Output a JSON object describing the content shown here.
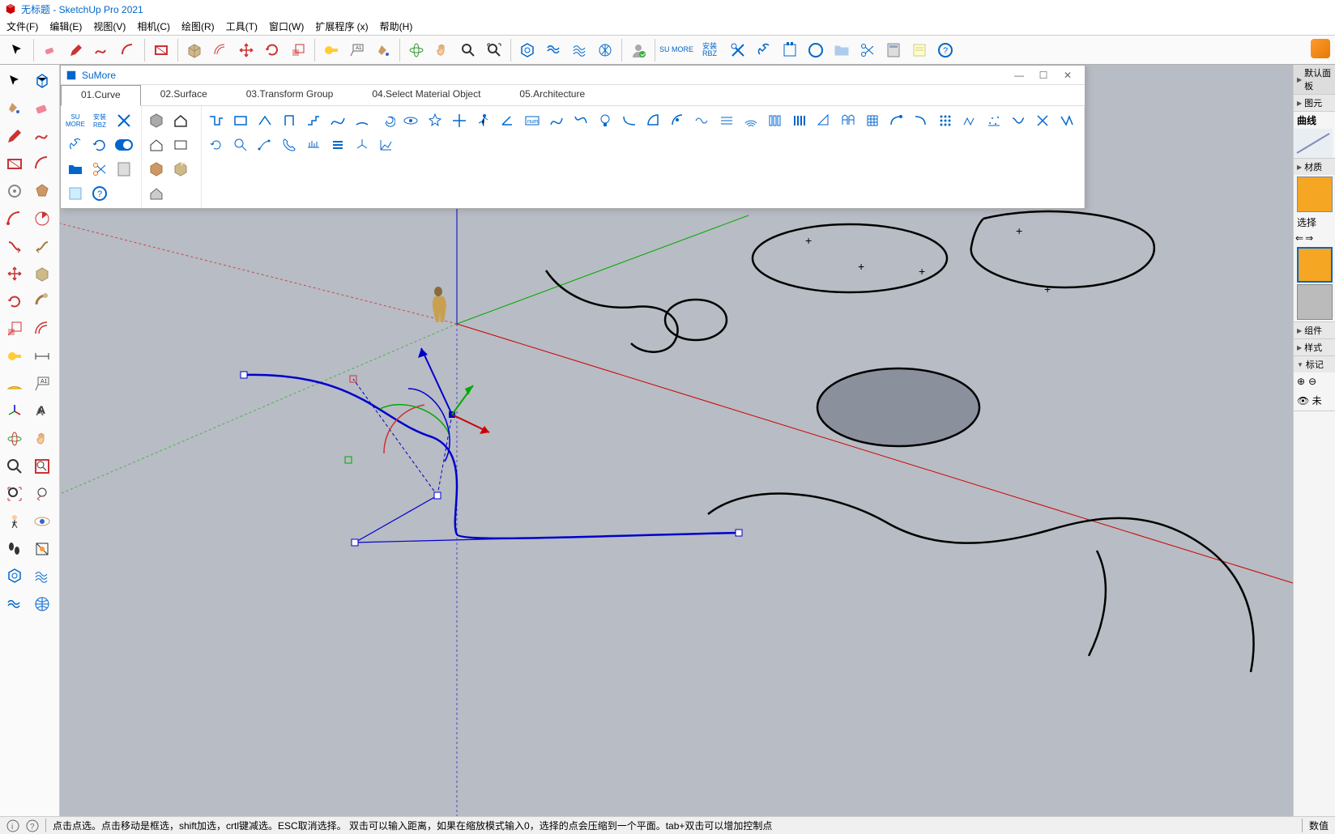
{
  "title": "无标题 - SketchUp Pro 2021",
  "menubar": [
    "文件(F)",
    "编辑(E)",
    "视图(V)",
    "相机(C)",
    "绘图(R)",
    "工具(T)",
    "窗口(W)",
    "扩展程序 (x)",
    "帮助(H)"
  ],
  "sumore": {
    "title": "SuMore",
    "tabs": [
      "01.Curve",
      "02.Surface",
      "03.Transform Group",
      "04.Select Material Object",
      "05.Architecture"
    ],
    "active_tab": 0
  },
  "right_panel": {
    "sections": [
      "默认面板",
      "图元",
      "曲线",
      "材质",
      "选择",
      "组件",
      "样式",
      "标记"
    ],
    "select_label": "选择",
    "curve_label": "曲线"
  },
  "statusbar": {
    "text": "点击点选。点击移动是框选，shift加选，crtl键减选。ESC取消选择。 双击可以输入距离，如果在缩放模式输入0，选择的点会压缩到一个平面。tab+双击可以增加控制点",
    "right": "数值"
  },
  "toolbar_labels": {
    "su_more": "SU MORE",
    "install_rbz": "安装 RBZ"
  }
}
